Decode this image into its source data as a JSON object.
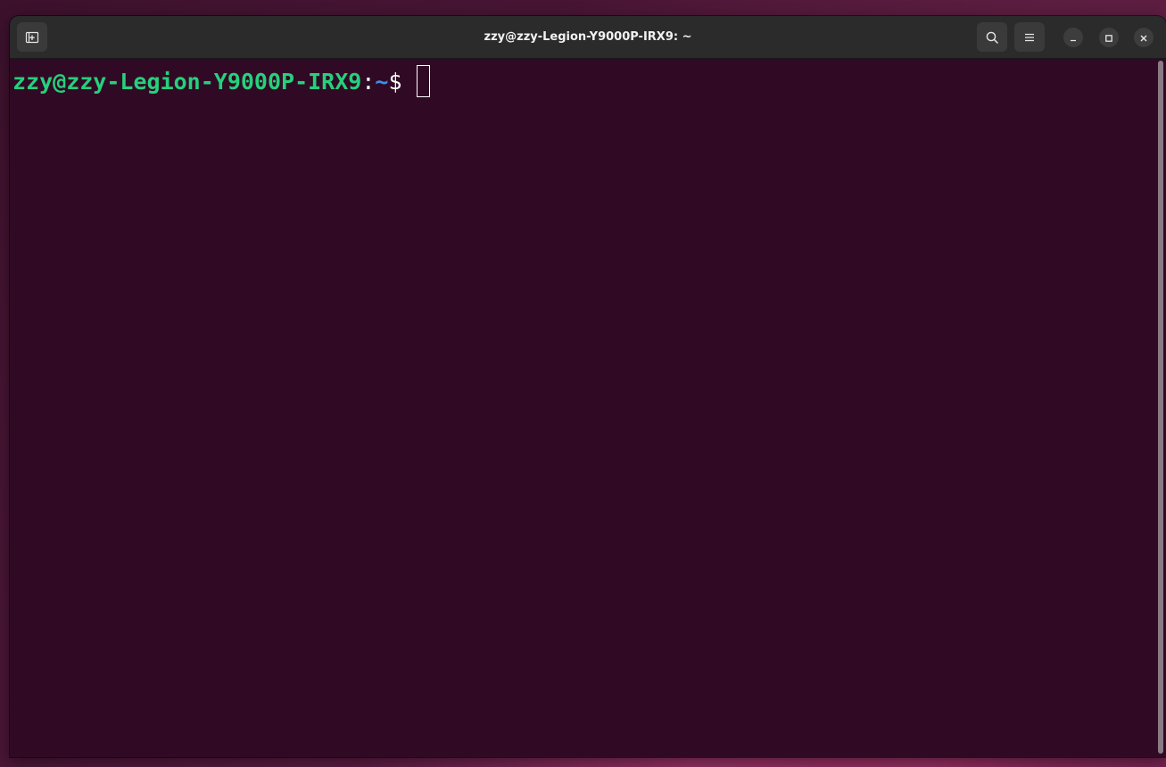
{
  "window": {
    "title": "zzy@zzy-Legion-Y9000P-IRX9: ~"
  },
  "headerbar": {
    "new_tab_icon": "new-tab-icon",
    "search_icon": "search-icon",
    "menu_icon": "hamburger-menu-icon",
    "minimize_icon": "minimize-icon",
    "maximize_icon": "maximize-icon",
    "close_icon": "close-icon"
  },
  "terminal": {
    "prompt_user_host": "zzy@zzy-Legion-Y9000P-IRX9",
    "prompt_colon": ":",
    "prompt_path": "~",
    "prompt_symbol": "$",
    "input": ""
  },
  "colors": {
    "terminal_bg": "#300a24",
    "headerbar_bg": "#2b2b2b",
    "prompt_user": "#26d07c",
    "prompt_path": "#3b8eea",
    "text": "#ffffff"
  }
}
